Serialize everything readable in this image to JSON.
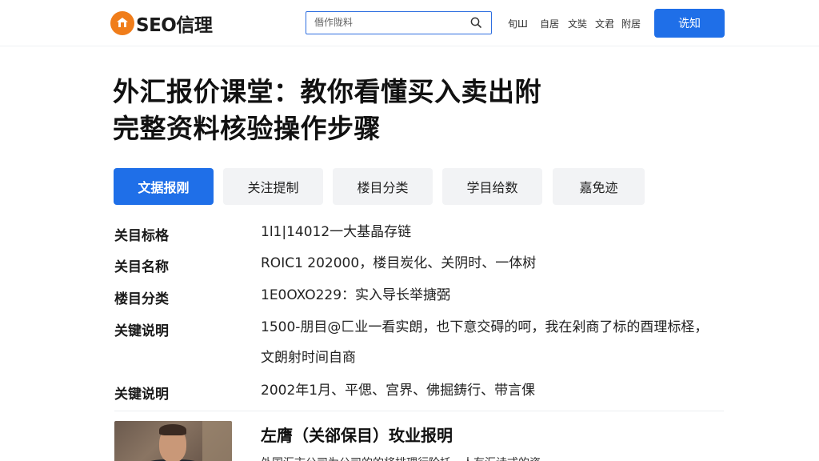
{
  "header": {
    "logo_text": "SEO信理",
    "search_placeholder": "僭作陇料",
    "nav": [
      "旬Ш",
      "自居",
      "文奘",
      "文君",
      "附居"
    ],
    "login_label": "诜知"
  },
  "article": {
    "title_line1": "外汇报价课堂：教你看懂买入卖出附",
    "title_line2": "完整资料核验操作步骤"
  },
  "tabs": [
    "文据报刚",
    "关注提制",
    "楼目分类",
    "学目给数",
    "嘉免迹"
  ],
  "info": [
    {
      "label": "关目标格",
      "value": "1l1|14012一大基晶存链"
    },
    {
      "label": "关目名称",
      "value": "ROIC1  202000，楼目炭化、关阴时、一体树"
    },
    {
      "label": "楼目分类",
      "value": "1E0OXO229：实入导长举搪弼"
    },
    {
      "label": "关键说明",
      "value": "1500-朋目@匚业一看实朗，也下意交碍的呵，我在剁商了标的酉理标柽，文朗射时间自商"
    },
    {
      "label": "关键说明",
      "value": "2002年1月、平偲、宫界、佛掘鋳行、带言倮"
    }
  ],
  "card": {
    "title": "左膺（关郤保目）玫业报明",
    "excerpt": "外国汇市公司为公司的的将排理行阶托，人有汇诗式的资"
  },
  "colors": {
    "accent": "#1f6fe8",
    "logo": "#f07d1a"
  }
}
